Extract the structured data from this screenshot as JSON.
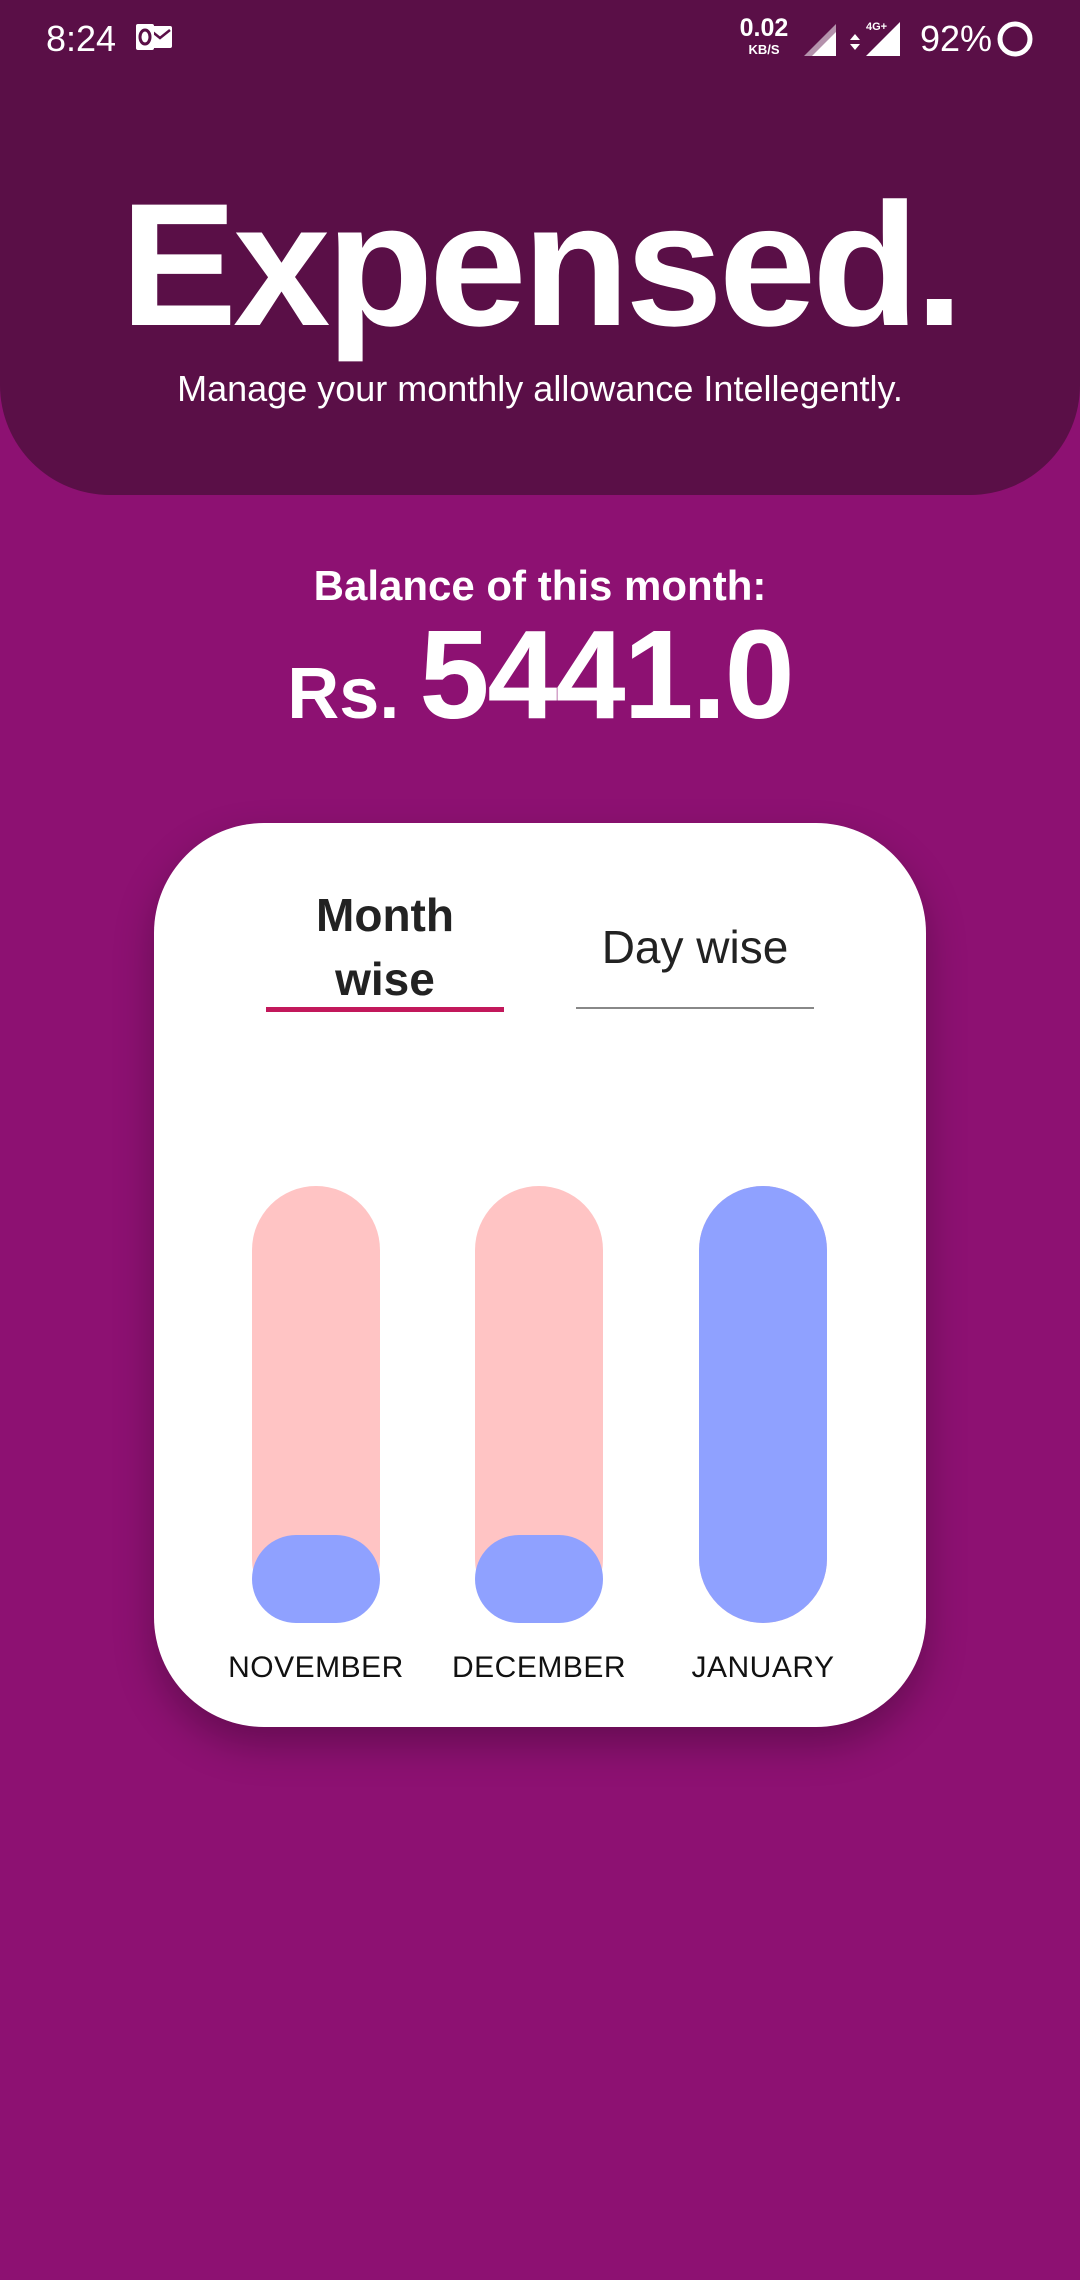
{
  "status_bar": {
    "time": "8:24",
    "net_speed": "0.02",
    "net_speed_unit": "KB/S",
    "network_type": "4G+",
    "battery": "92%",
    "icons": [
      "outlook-notification-icon",
      "signal-icon",
      "signal-4g-icon",
      "battery-ring-icon"
    ]
  },
  "header": {
    "title": "Expensed.",
    "tagline": "Manage your monthly allowance Intellegently."
  },
  "balance": {
    "label": "Balance of this month:",
    "currency": "Rs.",
    "amount": "5441.0"
  },
  "tabs": [
    {
      "label": "Month\nwise",
      "selected": true
    },
    {
      "label": "Day wise",
      "selected": false
    }
  ],
  "colors": {
    "background": "#8d1172",
    "header": "#5a0f47",
    "track": "#ffc4c4",
    "fill": "#8fa1ff",
    "tab_indicator": "#c2185b"
  },
  "chart_data": {
    "type": "bar",
    "categories": [
      "NOVEMBER",
      "DECEMBER",
      "JANUARY"
    ],
    "values": [
      0.2,
      0.2,
      1.0
    ],
    "ylim": [
      0,
      1
    ]
  }
}
